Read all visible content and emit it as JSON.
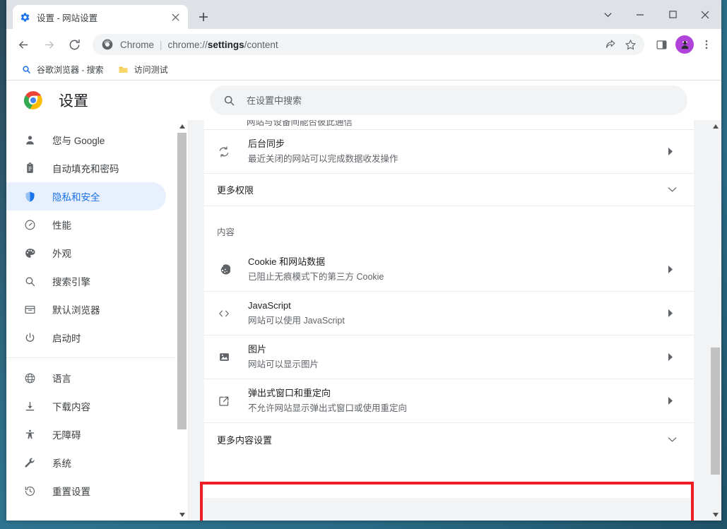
{
  "window": {
    "controls": [
      {
        "name": "tab-search-chevron",
        "glyph": "⌄"
      },
      {
        "name": "minimize",
        "glyph": "—"
      },
      {
        "name": "maximize",
        "glyph": "□"
      },
      {
        "name": "close",
        "glyph": "✕"
      }
    ]
  },
  "tab": {
    "title": "设置 - 网站设置",
    "favicon": "gear-icon",
    "close_label": "✕",
    "new_tab_label": "+"
  },
  "toolbar": {
    "back": "←",
    "forward": "→",
    "reload": "⟳",
    "omnibox": {
      "icon": "chrome-icon",
      "scheme": "Chrome",
      "separator": "|",
      "url_prefix": "chrome://",
      "url_bold": "settings",
      "url_suffix": "/content",
      "full_url": "chrome://settings/content"
    },
    "share_label": "share-icon",
    "bookmark_label": "star-icon",
    "side_panel_label": "side-panel-icon",
    "profile_label": "avatar",
    "menu_label": "⋮"
  },
  "bookmarks": [
    {
      "label": "谷歌浏览器 - 搜索",
      "icon": "search-icon"
    },
    {
      "label": "访问测试",
      "icon": "folder-icon"
    }
  ],
  "settings": {
    "title": "设置",
    "search_placeholder": "在设置中搜索",
    "search_value": ""
  },
  "sidebar": {
    "groups": [
      {
        "items": [
          {
            "label": "您与 Google",
            "icon": "person-icon",
            "active": false
          },
          {
            "label": "自动填充和密码",
            "icon": "clipboard-icon",
            "active": false
          },
          {
            "label": "隐私和安全",
            "icon": "shield-icon",
            "active": true
          },
          {
            "label": "性能",
            "icon": "speedometer-icon",
            "active": false
          },
          {
            "label": "外观",
            "icon": "palette-icon",
            "active": false
          },
          {
            "label": "搜索引擎",
            "icon": "magnifier-icon",
            "active": false
          },
          {
            "label": "默认浏览器",
            "icon": "browser-window-icon",
            "active": false
          },
          {
            "label": "启动时",
            "icon": "power-icon",
            "active": false
          }
        ]
      },
      {
        "items": [
          {
            "label": "语言",
            "icon": "globe-icon",
            "active": false
          },
          {
            "label": "下载内容",
            "icon": "download-icon",
            "active": false
          },
          {
            "label": "无障碍",
            "icon": "accessibility-icon",
            "active": false
          },
          {
            "label": "系统",
            "icon": "wrench-icon",
            "active": false
          },
          {
            "label": "重置设置",
            "icon": "history-restore-icon",
            "active": false
          }
        ]
      }
    ]
  },
  "content": {
    "partial_top_text": "网站与设备间能否彼此通信",
    "rows_top": [
      {
        "title": "后台同步",
        "sub": "最近关闭的网站可以完成数据收发操作",
        "icon": "sync-icon",
        "arrow": "▸"
      }
    ],
    "more_permissions": {
      "label": "更多权限",
      "chevron": "⌄"
    },
    "section_label": "内容",
    "rows_content": [
      {
        "title": "Cookie 和网站数据",
        "sub": "已阻止无痕模式下的第三方 Cookie",
        "icon": "cookie-icon",
        "arrow": "▸",
        "highlighted": false
      },
      {
        "title": "JavaScript",
        "sub": "网站可以使用 JavaScript",
        "icon": "code-icon",
        "arrow": "▸",
        "highlighted": false
      },
      {
        "title": "图片",
        "sub": "网站可以显示图片",
        "icon": "image-icon",
        "arrow": "▸",
        "highlighted": false
      },
      {
        "title": "弹出式窗口和重定向",
        "sub": "不允许网站显示弹出式窗口或使用重定向",
        "icon": "external-link-icon",
        "arrow": "▸",
        "highlighted": true
      }
    ],
    "more_content_settings": {
      "label": "更多内容设置",
      "chevron": "⌄"
    }
  },
  "colors": {
    "accent": "#1a73e8",
    "active_pill": "#e8f0fe",
    "highlight_border": "#ee1c25",
    "avatar": "#b044d8",
    "page_bg": "#f1f3f4",
    "text_primary": "#202124",
    "text_secondary": "#5f6368"
  },
  "scrollbars": {
    "sidebar": {
      "up": "▲",
      "down": "▼"
    },
    "page": {
      "up": "▲",
      "down": "▼"
    }
  }
}
